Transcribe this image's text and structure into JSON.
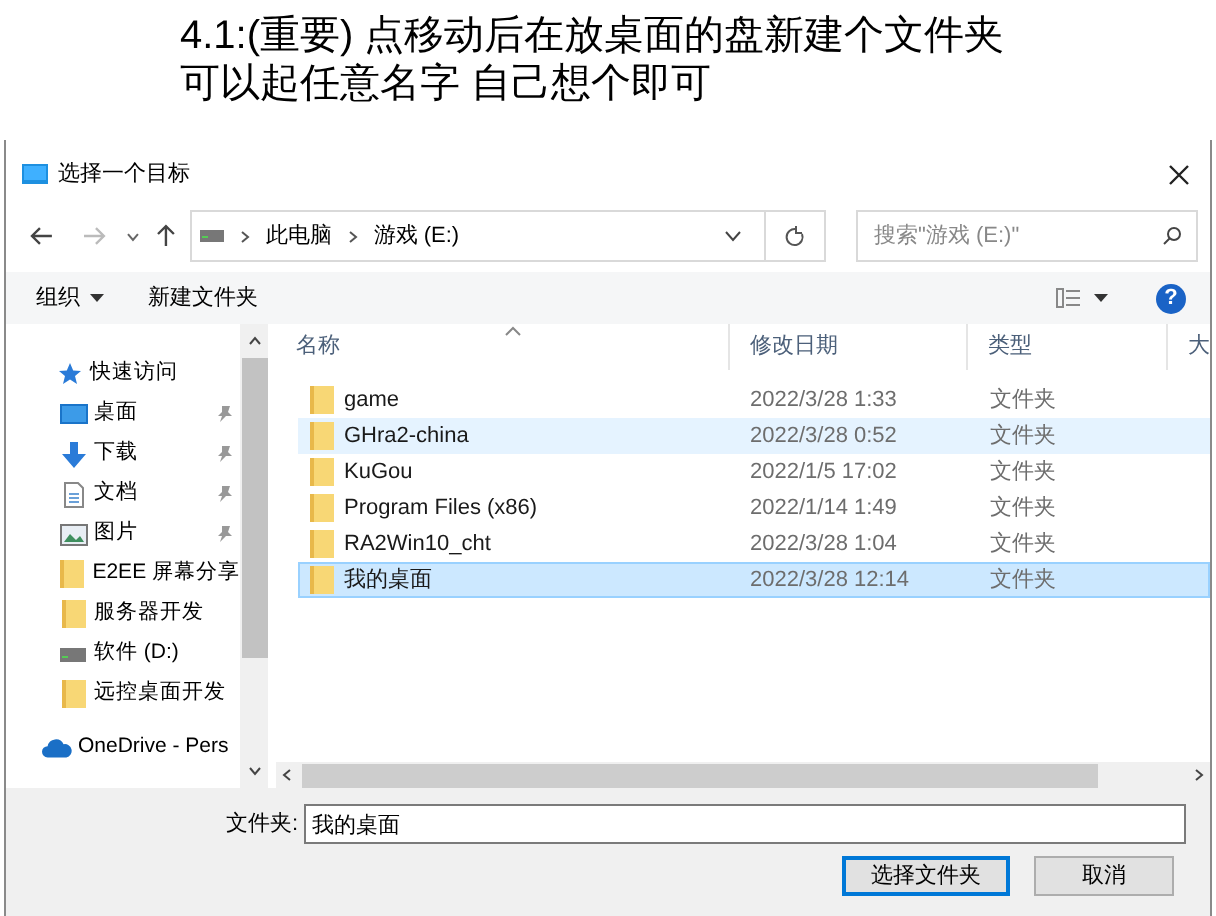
{
  "instruction": {
    "lines": [
      "4.1:(重要) 点移动后在放桌面的盘新建个文件夹",
      "可以起任意名字 自己想个即可"
    ]
  },
  "window": {
    "title": "选择一个目标"
  },
  "address": {
    "path": [
      "此电脑",
      "游戏 (E:)"
    ]
  },
  "search": {
    "placeholder": "搜索\"游戏 (E:)\""
  },
  "toolbar": {
    "organize": "组织",
    "new_folder": "新建文件夹",
    "help": "?"
  },
  "nav": [
    {
      "kind": "star",
      "label": "快速访问",
      "pinned": false
    },
    {
      "kind": "desktop",
      "label": "桌面",
      "pinned": true
    },
    {
      "kind": "download",
      "label": "下载",
      "pinned": true
    },
    {
      "kind": "document",
      "label": "文档",
      "pinned": true
    },
    {
      "kind": "picture",
      "label": "图片",
      "pinned": true
    },
    {
      "kind": "folder",
      "label": "E2EE 屏幕分享",
      "pinned": false
    },
    {
      "kind": "folder",
      "label": "服务器开发",
      "pinned": false
    },
    {
      "kind": "drive",
      "label": "软件 (D:)",
      "pinned": false
    },
    {
      "kind": "folder",
      "label": "远控桌面开发",
      "pinned": false
    },
    {
      "kind": "cloud",
      "label": "OneDrive - Pers",
      "pinned": false
    }
  ],
  "columns": [
    "名称",
    "修改日期",
    "类型",
    "大"
  ],
  "files": [
    {
      "name": "game",
      "date": "2022/3/28 1:33",
      "type": "文件夹",
      "selected": false,
      "hovered": false
    },
    {
      "name": "GHra2-china",
      "date": "2022/3/28 0:52",
      "type": "文件夹",
      "selected": false,
      "hovered": true
    },
    {
      "name": "KuGou",
      "date": "2022/1/5 17:02",
      "type": "文件夹",
      "selected": false,
      "hovered": false
    },
    {
      "name": "Program Files (x86)",
      "date": "2022/1/14 1:49",
      "type": "文件夹",
      "selected": false,
      "hovered": false
    },
    {
      "name": "RA2Win10_cht",
      "date": "2022/3/28 1:04",
      "type": "文件夹",
      "selected": false,
      "hovered": false
    },
    {
      "name": "我的桌面",
      "date": "2022/3/28 12:14",
      "type": "文件夹",
      "selected": true,
      "hovered": false
    }
  ],
  "folder_field": {
    "label": "文件夹:",
    "value": "我的桌面"
  },
  "buttons": [
    {
      "kind": "primary",
      "label": "选择文件夹"
    },
    {
      "kind": "normal",
      "label": "取消"
    }
  ]
}
